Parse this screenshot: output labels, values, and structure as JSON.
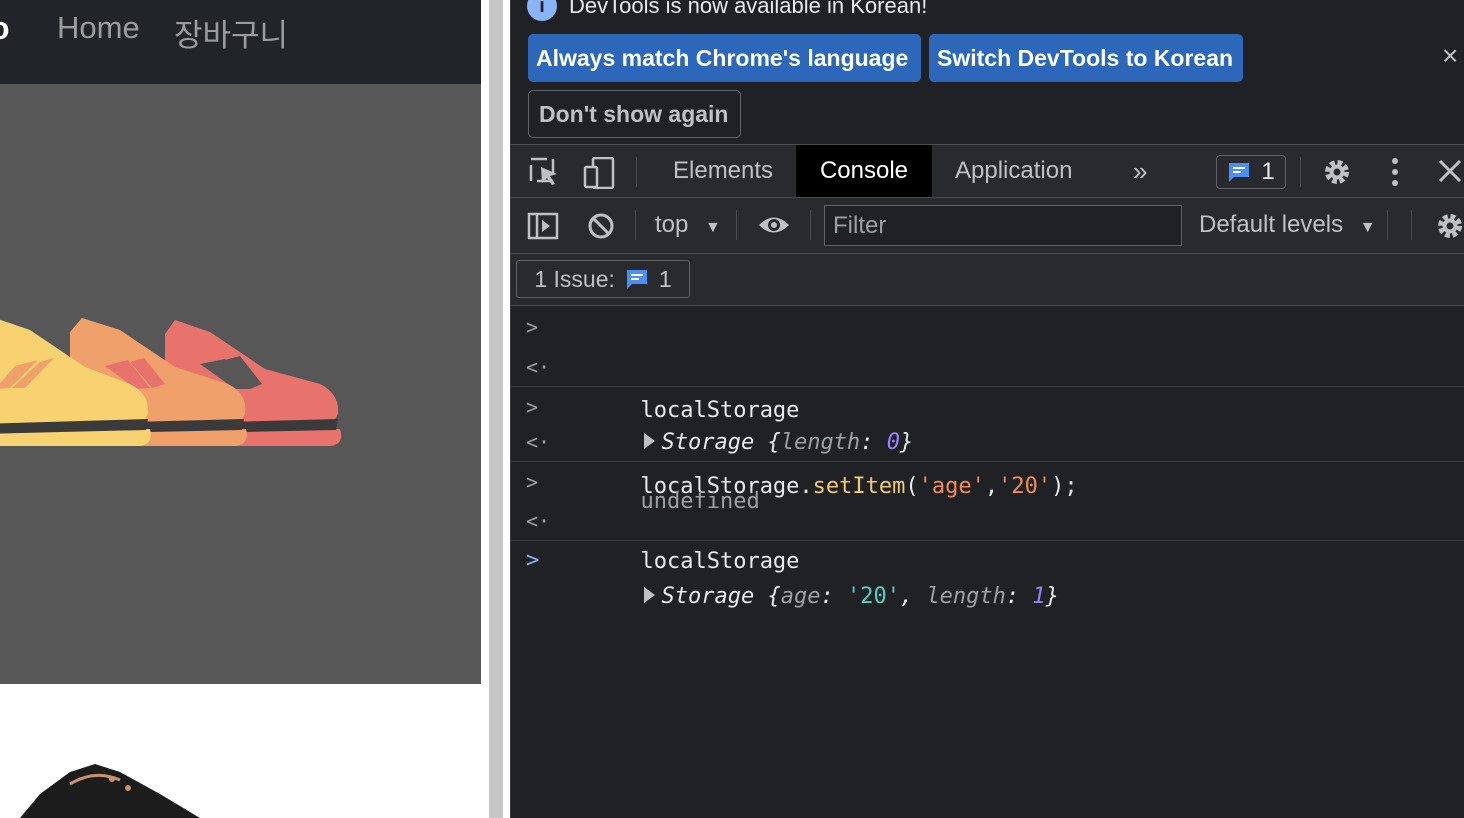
{
  "webpage": {
    "brand": "o",
    "nav": [
      {
        "label": "Home"
      },
      {
        "label": "장바구니"
      }
    ]
  },
  "devtools": {
    "infobar": {
      "message": "DevTools is now available in Korean!",
      "buttons": {
        "match": "Always match Chrome's language",
        "switch": "Switch DevTools to Korean",
        "dont_show": "Don't show again"
      },
      "close": "×"
    },
    "tabs": [
      {
        "label": "Elements"
      },
      {
        "label": "Console",
        "active": true
      },
      {
        "label": "Application"
      }
    ],
    "more_tabs": "»",
    "issue_count": "1",
    "toolbar": {
      "context": "top",
      "filter_placeholder": "Filter",
      "levels": "Default levels"
    },
    "issues_bar": {
      "label": "1 Issue:",
      "count": "1"
    },
    "console": [
      {
        "type": "input",
        "code": "localStorage"
      },
      {
        "type": "output",
        "object": "Storage",
        "props": [
          {
            "key": "length",
            "value": "0"
          }
        ]
      },
      {
        "type": "input",
        "code": {
          "obj": "localStorage.",
          "fn": "setItem",
          "open": "(",
          "arg1": "'age'",
          "comma": ",",
          "arg2": "'20'",
          "close": ");"
        }
      },
      {
        "type": "output",
        "text": "undefined"
      },
      {
        "type": "input",
        "code": "localStorage"
      },
      {
        "type": "output",
        "object": "Storage",
        "props": [
          {
            "key": "age",
            "value": "'20'"
          },
          {
            "key": "length",
            "value": "1"
          }
        ]
      }
    ],
    "colors": {
      "accent_button": "#2d67b9",
      "panel_bg": "#202124",
      "toolbar_bg": "#292a2d",
      "string": "#f28b54",
      "function": "#f2ca73",
      "number": "#9980ff",
      "prompt": "#8ab4f8"
    }
  }
}
